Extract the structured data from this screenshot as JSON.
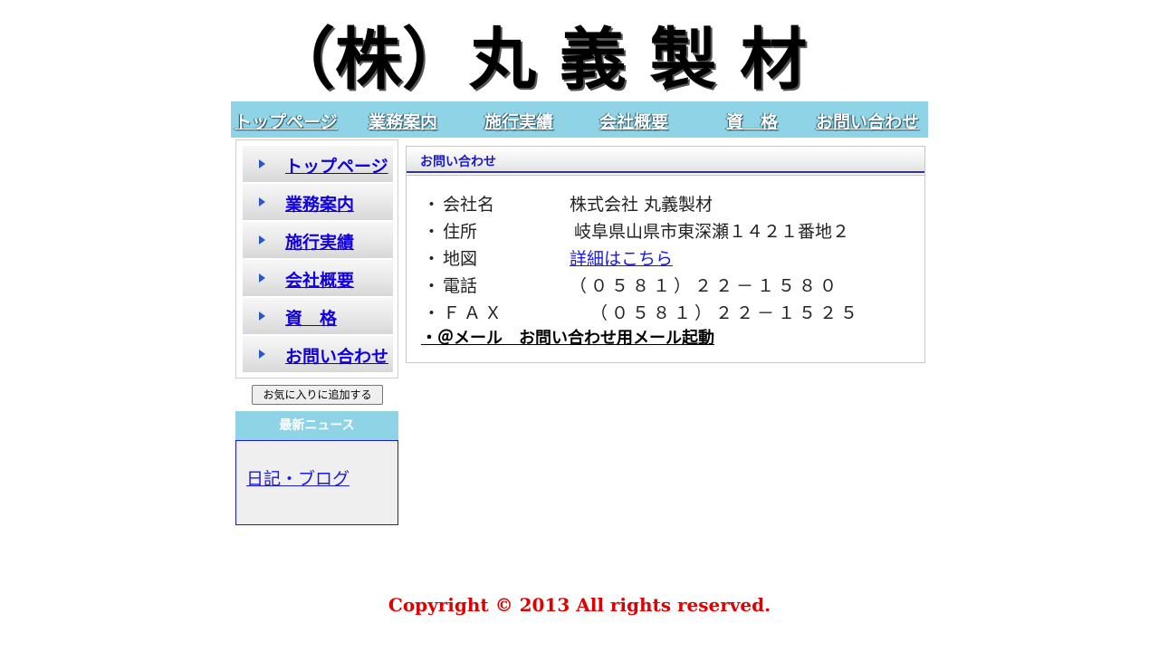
{
  "header": {
    "logo_text": "（株）丸 義 製 材"
  },
  "topnav": {
    "items": [
      {
        "label": "トップページ"
      },
      {
        "label": "業務案内"
      },
      {
        "label": "施行実績"
      },
      {
        "label": "会社概要"
      },
      {
        "label": "資　格"
      },
      {
        "label": "お問い合わせ"
      }
    ]
  },
  "sidebar": {
    "items": [
      {
        "label": "トップページ"
      },
      {
        "label": "業務案内"
      },
      {
        "label": "施行実績"
      },
      {
        "label": "会社概要"
      },
      {
        "label": "資　格"
      },
      {
        "label": "お問い合わせ"
      }
    ],
    "bookmark_button": "お気に入りに追加する",
    "news": {
      "title": "最新ニュース",
      "link": "日記・ブログ"
    }
  },
  "main": {
    "section_title": "お問い合わせ",
    "bullet": "・",
    "rows": [
      {
        "label": "会社名",
        "value": "株式会社 丸義製材"
      },
      {
        "label": "住所",
        "value": "岐阜県山県市東深瀬１４２１番地２"
      },
      {
        "label": "地図",
        "value": "詳細はこちら"
      },
      {
        "label": "電話",
        "value": "（０５８１）２２－１５８０"
      },
      {
        "label": "ＦＡＸ",
        "value": "（０５８１）２２－１５２５"
      }
    ],
    "mail_link": "・＠メール　お問い合わせ用メール起動"
  },
  "footer": {
    "copyright": "Copyright © 2013 All rights reserved."
  },
  "colors": {
    "nav_bg": "#8fd3e7",
    "link": "#1100dd",
    "copyright": "#e00000",
    "panel_accent": "#2b2bd8"
  }
}
